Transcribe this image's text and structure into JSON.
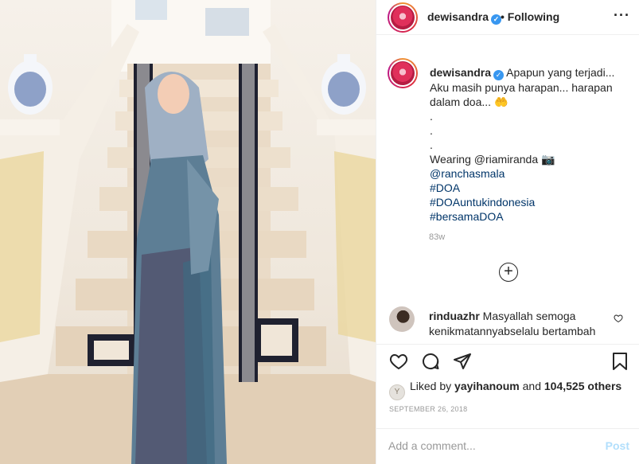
{
  "header": {
    "username": "dewisandra",
    "separator": "•",
    "follow_label": "Following",
    "more_label": "···"
  },
  "caption": {
    "username": "dewisandra",
    "lines": [
      "Apapun yang terjadi...",
      "Aku masih punya harapan... harapan",
      "dalam doa... 🤲",
      ".",
      ".",
      ".",
      "Wearing @riamiranda 📷"
    ],
    "links": [
      "@ranchasmala",
      "#DOA",
      "#DOAuntukindonesia",
      "#bersamaDOA"
    ],
    "age": "83w"
  },
  "load_more_symbol": "+",
  "comment": {
    "username": "rinduazhr",
    "text": "Masyallah semoga kenikmatannyabselalu bertambah"
  },
  "likes": {
    "prefix": "Liked by",
    "user": "yayihanoum",
    "middle": "and",
    "count": "104,525 others"
  },
  "date": "SEPTEMBER 26, 2018",
  "add_comment": {
    "placeholder": "Add a comment...",
    "post_label": "Post"
  },
  "icons": {
    "like": "heart-icon",
    "comment": "comment-icon",
    "share": "share-icon",
    "save": "bookmark-icon",
    "more": "more-icon",
    "verified": "verified-badge-icon"
  },
  "colors": {
    "link": "#003569",
    "verified": "#3897f0",
    "post_disabled": "#b2dffc",
    "muted": "#999999"
  }
}
